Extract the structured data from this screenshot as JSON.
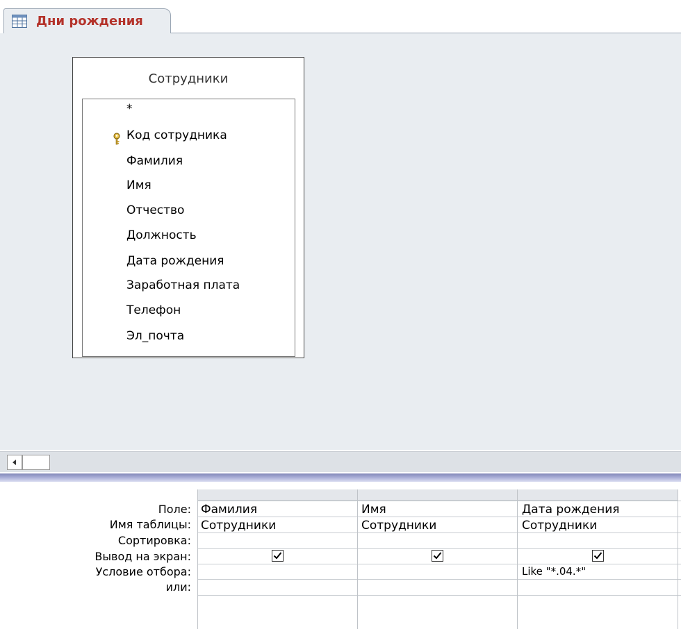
{
  "tab": {
    "label": "Дни рождения",
    "icon": "query-icon"
  },
  "table": {
    "title": "Сотрудники",
    "fields": [
      {
        "label": "*",
        "primary_key": false
      },
      {
        "label": "Код сотрудника",
        "primary_key": true
      },
      {
        "label": "Фамилия",
        "primary_key": false
      },
      {
        "label": "Имя",
        "primary_key": false
      },
      {
        "label": "Отчество",
        "primary_key": false
      },
      {
        "label": "Должность",
        "primary_key": false
      },
      {
        "label": "Дата рождения",
        "primary_key": false
      },
      {
        "label": "Заработная плата",
        "primary_key": false
      },
      {
        "label": "Телефон",
        "primary_key": false
      },
      {
        "label": "Эл_почта",
        "primary_key": false
      }
    ]
  },
  "grid": {
    "row_labels": {
      "field": "Поле:",
      "table": "Имя таблицы:",
      "sort": "Сортировка:",
      "show": "Вывод на экран:",
      "criteria": "Условие отбора:",
      "or": "или:"
    },
    "columns": [
      {
        "field": "Фамилия",
        "table": "Сотрудники",
        "sort": "",
        "show": true,
        "criteria": "",
        "or": ""
      },
      {
        "field": "Имя",
        "table": "Сотрудники",
        "sort": "",
        "show": true,
        "criteria": "",
        "or": ""
      },
      {
        "field": "Дата рождения",
        "table": "Сотрудники",
        "sort": "",
        "show": true,
        "criteria": "Like \"*.04.*\"",
        "or": ""
      }
    ]
  },
  "colors": {
    "tab_label": "#b4332b",
    "pane_background": "#e9edf1"
  }
}
